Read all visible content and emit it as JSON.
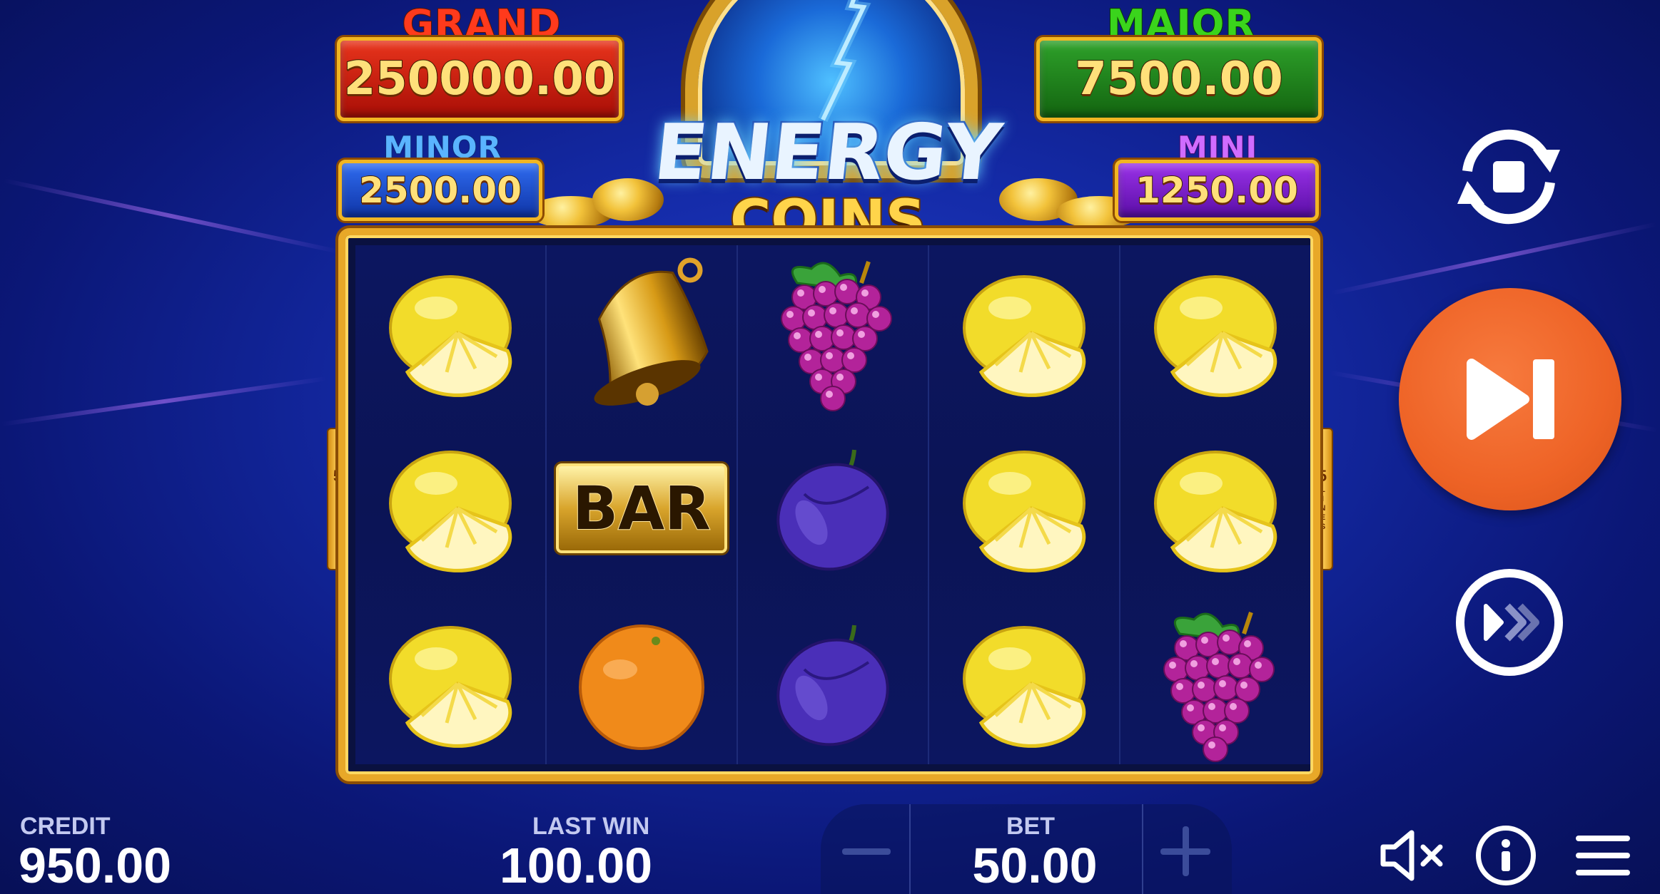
{
  "jackpots": {
    "grand": {
      "label": "GRAND",
      "value": "250000.00"
    },
    "major": {
      "label": "MAJOR",
      "value": "7500.00"
    },
    "minor": {
      "label": "MINOR",
      "value": "2500.00"
    },
    "mini": {
      "label": "MINI",
      "value": "1250.00"
    }
  },
  "logo": {
    "line1": "ENERGY",
    "line2": "COINS"
  },
  "lines": {
    "count": "5",
    "word": "LINES"
  },
  "reels": [
    [
      "lemon",
      "lemon",
      "lemon"
    ],
    [
      "bell",
      "bar",
      "orange"
    ],
    [
      "grapes",
      "plum",
      "plum"
    ],
    [
      "lemon",
      "lemon",
      "lemon"
    ],
    [
      "lemon",
      "lemon",
      "grapes"
    ]
  ],
  "bar_symbol_text": "BAR",
  "footer": {
    "credit_label": "CREDIT",
    "credit_value": "950.00",
    "last_win_label": "LAST WIN",
    "last_win_value": "100.00",
    "bet_label": "BET",
    "bet_value": "50.00"
  },
  "controls": {
    "autoplay_icon": "autoplay-icon",
    "spin_icon": "skip-play-icon",
    "turbo_icon": "turbo-icon",
    "sound_icon": "sound-muted-icon",
    "info_icon": "info-icon",
    "menu_icon": "menu-icon"
  },
  "colors": {
    "grand": "#c8180c",
    "major": "#1f8a18",
    "minor": "#1c4fd8",
    "mini": "#7a1fc8",
    "spin_button": "#ee6326",
    "frame_gold": "#e8a828"
  }
}
